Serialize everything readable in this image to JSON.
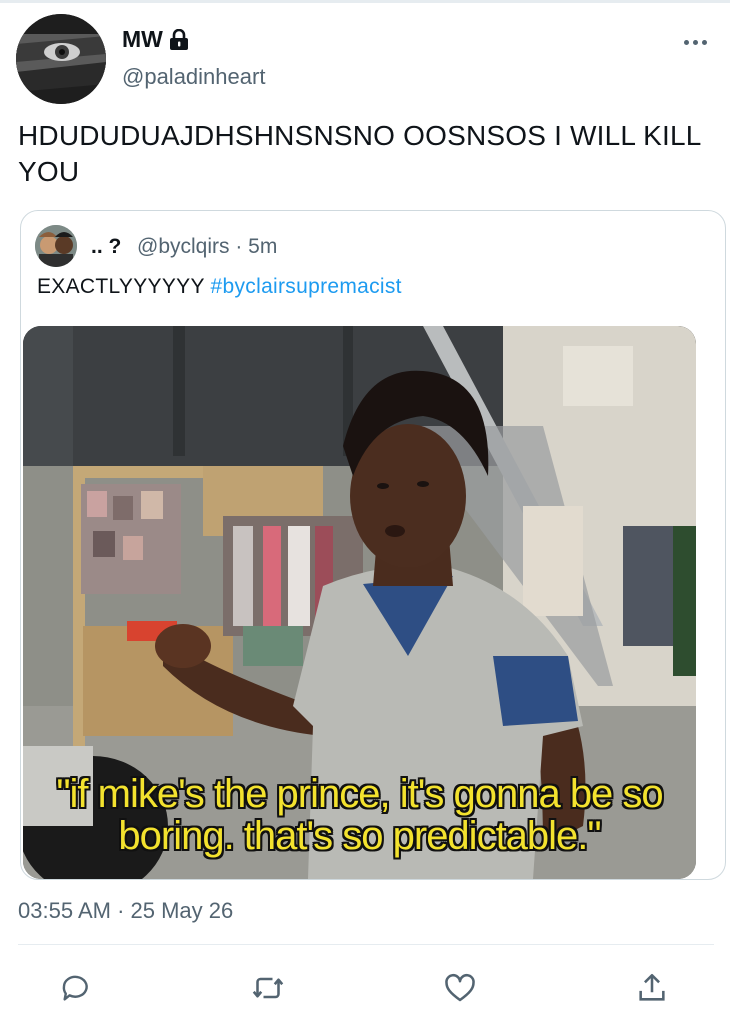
{
  "tweet": {
    "display_name": "MW",
    "handle": "@paladinheart",
    "text": "HDUDUDUAJDHSHNSNSNO OOSNSOS I WILL KILL YOU",
    "timestamp": "03:55 AM · 25 May 26",
    "icons": {
      "lock": "lock-icon",
      "more": "more-icon",
      "reply": "reply-icon",
      "retweet": "retweet-icon",
      "like": "heart-icon",
      "share": "share-icon"
    }
  },
  "quote": {
    "display_name": ".. ?",
    "meta": "@byclqirs · 5m",
    "text": "EXACTLYYYYYY",
    "hashtag": "#byclairsupremacist",
    "media": {
      "caption_line1": "\"if mike's the prince, it's gonna be so",
      "caption_line2": "boring. that's so predictable.\""
    }
  },
  "colors": {
    "text": "#0f1419",
    "secondary": "#536471",
    "link": "#1d9bf0",
    "border": "#cfd9de",
    "caption": "#f3e22e"
  }
}
